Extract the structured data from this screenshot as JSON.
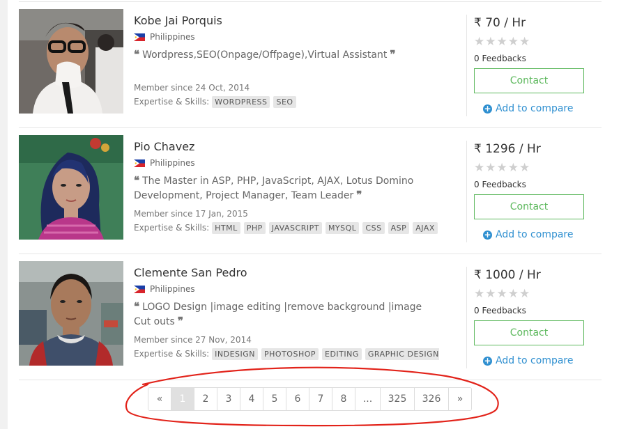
{
  "currency_symbol": "₹",
  "stars_glyph": "★★★★★",
  "colors": {
    "contact_green": "#5cb85c",
    "compare_blue": "#2e8fd0",
    "annotation_red": "#e2231a"
  },
  "freelancers": [
    {
      "name": "Kobe Jai Porquis",
      "country": "Philippines",
      "description": "Wordpress,SEO(Onpage/Offpage),Virtual Assistant",
      "member_since": "Member since 24 Oct, 2014",
      "skills_label": "Expertise & Skills:",
      "skills": [
        "WORDPRESS",
        "SEO"
      ],
      "price": "70 / Hr",
      "rating": 0,
      "feedbacks": "0 Feedbacks",
      "contact_label": "Contact",
      "compare_label": "Add to compare"
    },
    {
      "name": "Pio Chavez",
      "country": "Philippines",
      "description": "The Master in ASP, PHP, JavaScript, AJAX, Lotus Domino Development, Project Manager, Team Leader",
      "member_since": "Member since 17 Jan, 2015",
      "skills_label": "Expertise & Skills:",
      "skills": [
        "HTML",
        "PHP",
        "JAVASCRIPT",
        "MYSQL",
        "CSS",
        "ASP",
        "AJAX"
      ],
      "price": "1296 / Hr",
      "rating": 0,
      "feedbacks": "0 Feedbacks",
      "contact_label": "Contact",
      "compare_label": "Add to compare"
    },
    {
      "name": "Clemente San Pedro",
      "country": "Philippines",
      "description": "LOGO Design |image editing |remove background |image Cut outs",
      "member_since": "Member since 27 Nov, 2014",
      "skills_label": "Expertise & Skills:",
      "skills": [
        "INDESIGN",
        "PHOTOSHOP",
        "EDITING",
        "GRAPHIC DESIGN"
      ],
      "price": "1000 / Hr",
      "rating": 0,
      "feedbacks": "0 Feedbacks",
      "contact_label": "Contact",
      "compare_label": "Add to compare"
    }
  ],
  "pagination": {
    "prev": "«",
    "pages": [
      "1",
      "2",
      "3",
      "4",
      "5",
      "6",
      "7",
      "8",
      "...",
      "325",
      "326"
    ],
    "next": "»",
    "current": "1"
  }
}
